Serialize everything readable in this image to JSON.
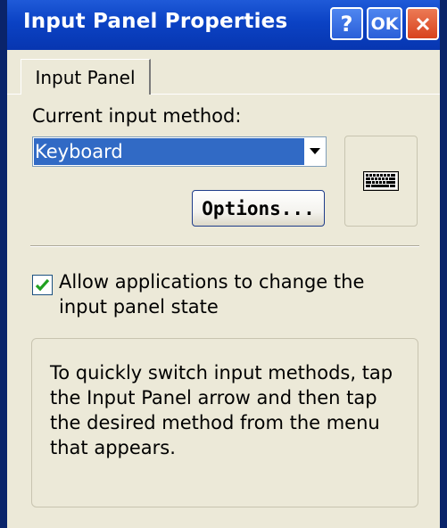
{
  "window": {
    "title": "Input Panel Properties",
    "help_label": "?",
    "ok_label": "OK"
  },
  "tabs": [
    {
      "label": "Input Panel",
      "selected": true
    }
  ],
  "input_method": {
    "label": "Current input method:",
    "selected": "Keyboard"
  },
  "options_button": {
    "label": "Options..."
  },
  "allow_change": {
    "checked": true,
    "label": "Allow applications to change the input panel state"
  },
  "info": {
    "text": "To quickly switch input methods, tap the Input Panel arrow and then tap the desired method from the menu that appears."
  },
  "icons": {
    "help": "help-icon",
    "ok": "ok-icon",
    "close": "close-icon",
    "dropdown_arrow": "chevron-down-icon",
    "keyboard": "keyboard-icon",
    "checkmark": "checkmark-icon"
  },
  "colors": {
    "titlebar": "#0b42c4",
    "close_button": "#d8431e",
    "selection": "#316ac5",
    "checkmark": "#21a121",
    "dialog_background": "#ece9d8"
  }
}
